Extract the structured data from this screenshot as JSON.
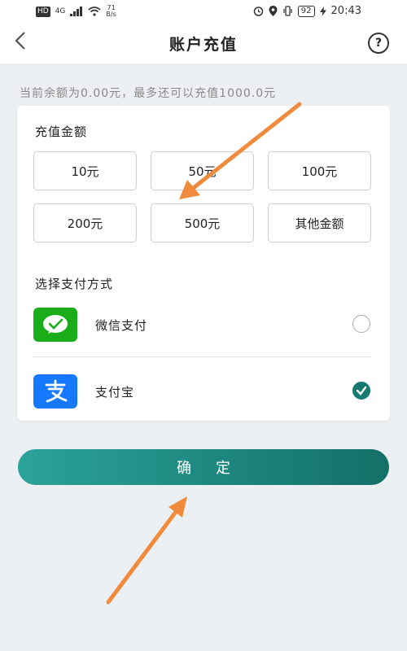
{
  "status_bar": {
    "hd": "HD",
    "network": "4G",
    "speed_value": "71",
    "speed_unit": "B/s",
    "battery": "92",
    "time": "20:43"
  },
  "header": {
    "title": "账户充值",
    "back_icon": "chevron-left-icon",
    "help_icon": "question-icon",
    "help_symbol": "?"
  },
  "balance_text": "当前余额为0.00元，最多还可以充值1000.0元",
  "amount_section": {
    "title": "充值金额",
    "options": [
      "10元",
      "50元",
      "100元",
      "200元",
      "500元",
      "其他金额"
    ]
  },
  "payment_section": {
    "title": "选择支付方式",
    "methods": [
      {
        "label": "微信支付",
        "icon": "wechat-pay-icon",
        "selected": false
      },
      {
        "label": "支付宝",
        "icon": "alipay-icon",
        "selected": true
      }
    ]
  },
  "confirm_label": "确定",
  "colors": {
    "accent": "#167a73",
    "wechat": "#1aad19",
    "alipay": "#1677ff",
    "annotation_arrow": "#f08a3c"
  }
}
